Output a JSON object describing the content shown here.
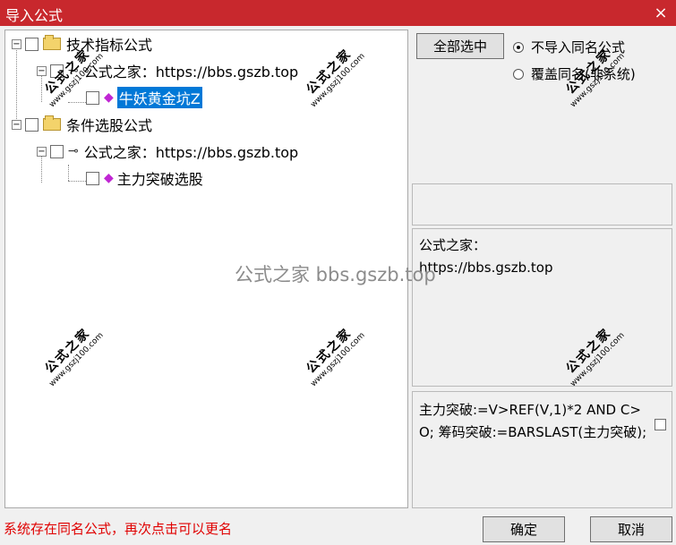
{
  "window": {
    "title": "导入公式",
    "close": "×"
  },
  "tree": {
    "n1": "技术指标公式",
    "n2": "公式之家：https://bbs.gszb.top",
    "n3": "牛妖黄金坑Z",
    "n4": "条件选股公式",
    "n5": "公式之家：https://bbs.gszb.top",
    "n6": "主力突破选股"
  },
  "right": {
    "select_all": "全部选中",
    "radio1": "不导入同名公式",
    "radio2": "覆盖同名(非系统)",
    "desc": "公式之家：\nhttps://bbs.gszb.top",
    "code": "主力突破:=V>REF(V,1)*2 AND C>O;\n筹码突破:=BARSLAST(主力突破);"
  },
  "footer": {
    "status": "系统存在同名公式，再次点击可以更名",
    "ok": "确定",
    "cancel": "取消"
  },
  "watermark": "公式之家 bbs.gszb.top",
  "stamp": {
    "cn": "公式之家",
    "url": "www.gszj100.com"
  }
}
